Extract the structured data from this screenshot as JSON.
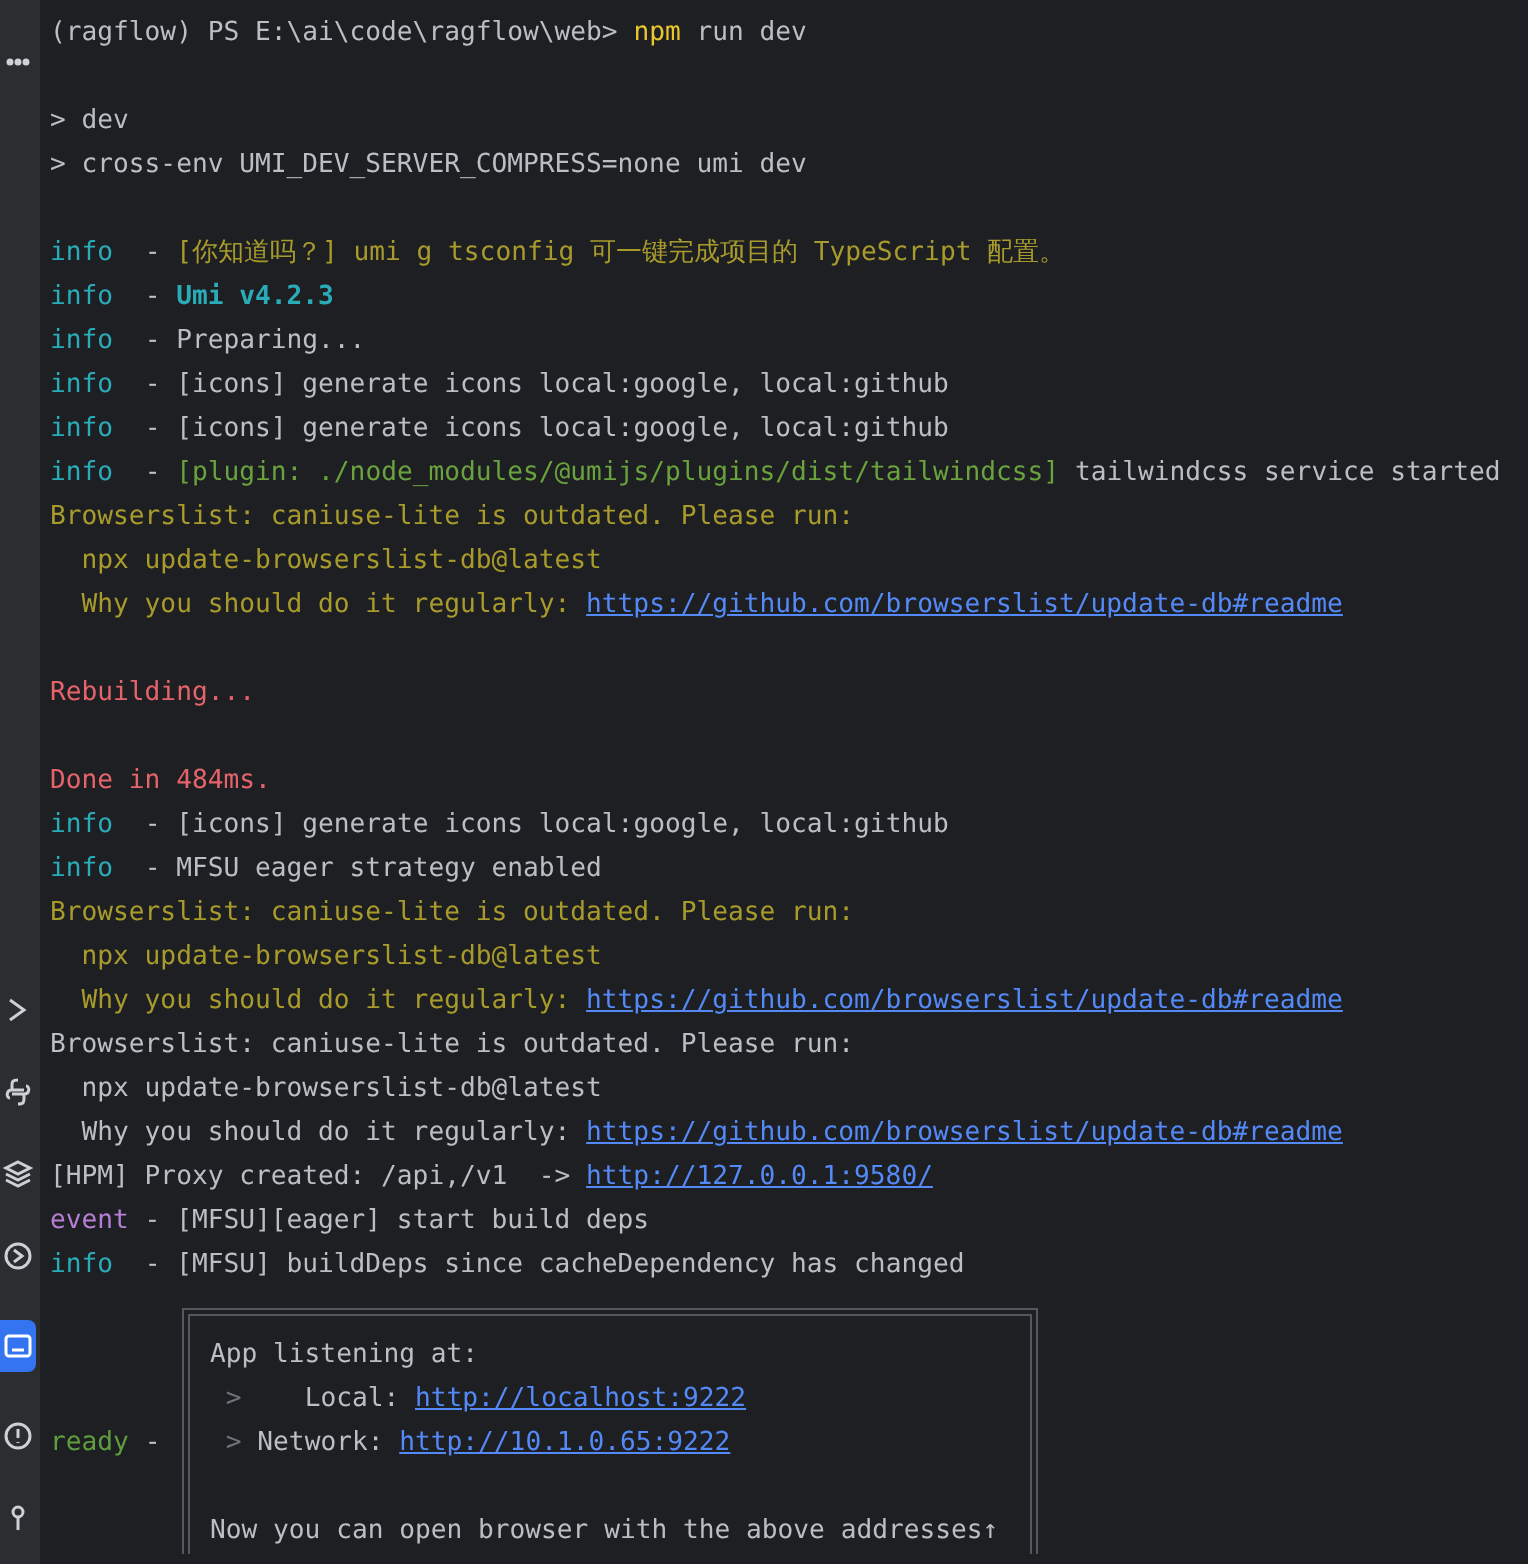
{
  "sidebar": {
    "items": [
      {
        "selected": false
      },
      {
        "selected": false
      },
      {
        "selected": false
      },
      {
        "selected": false
      },
      {
        "selected": false
      },
      {
        "selected": true
      },
      {
        "selected": false
      },
      {
        "selected": false
      }
    ]
  },
  "terminal": {
    "lines": [
      {
        "kind": "text",
        "segments": [
          {
            "kind": "plain",
            "text": "(ragflow) PS E:\\ai\\code\\ragflow\\web> "
          },
          {
            "kind": "command",
            "text": "npm"
          },
          {
            "kind": "plain",
            "text": " run dev"
          }
        ]
      },
      {
        "kind": "blank"
      },
      {
        "kind": "text",
        "segments": [
          {
            "kind": "plain",
            "text": "> dev"
          }
        ]
      },
      {
        "kind": "text",
        "segments": [
          {
            "kind": "plain",
            "text": "> cross-env UMI_DEV_SERVER_COMPRESS=none umi dev"
          }
        ]
      },
      {
        "kind": "blank"
      },
      {
        "kind": "text",
        "segments": [
          {
            "kind": "info",
            "text": "info"
          },
          {
            "kind": "plain",
            "text": "  - "
          },
          {
            "kind": "warn",
            "text": "[你知道吗？] umi g tsconfig 可一键完成项目的 TypeScript 配置。"
          }
        ]
      },
      {
        "kind": "text",
        "segments": [
          {
            "kind": "info",
            "text": "info"
          },
          {
            "kind": "plain",
            "text": "  - "
          },
          {
            "kind": "version",
            "text": "Umi v4.2.3"
          }
        ]
      },
      {
        "kind": "text",
        "segments": [
          {
            "kind": "info",
            "text": "info"
          },
          {
            "kind": "plain",
            "text": "  - Preparing..."
          }
        ]
      },
      {
        "kind": "text",
        "segments": [
          {
            "kind": "info",
            "text": "info"
          },
          {
            "kind": "plain",
            "text": "  - [icons] generate icons local:google, local:github"
          }
        ]
      },
      {
        "kind": "text",
        "segments": [
          {
            "kind": "info",
            "text": "info"
          },
          {
            "kind": "plain",
            "text": "  - [icons] generate icons local:google, local:github"
          }
        ]
      },
      {
        "kind": "text",
        "segments": [
          {
            "kind": "info",
            "text": "info"
          },
          {
            "kind": "plain",
            "text": "  - "
          },
          {
            "kind": "plugin",
            "text": "[plugin: ./node_modules/@umijs/plugins/dist/tailwindcss]"
          },
          {
            "kind": "plain",
            "text": " tailwindcss service started"
          }
        ]
      },
      {
        "kind": "text",
        "segments": [
          {
            "kind": "warn",
            "text": "Browserslist: caniuse-lite is outdated. Please run:"
          }
        ]
      },
      {
        "kind": "text",
        "segments": [
          {
            "kind": "warn",
            "text": "  npx update-browserslist-db@latest"
          }
        ]
      },
      {
        "kind": "text",
        "segments": [
          {
            "kind": "warn",
            "text": "  Why you should do it regularly: "
          },
          {
            "kind": "link",
            "text": "https://github.com/browserslist/update-db#readme"
          }
        ]
      },
      {
        "kind": "blank"
      },
      {
        "kind": "text",
        "segments": [
          {
            "kind": "error",
            "text": "Rebuilding..."
          }
        ]
      },
      {
        "kind": "blank"
      },
      {
        "kind": "text",
        "segments": [
          {
            "kind": "error",
            "text": "Done in 484ms."
          }
        ]
      },
      {
        "kind": "text",
        "segments": [
          {
            "kind": "info",
            "text": "info"
          },
          {
            "kind": "plain",
            "text": "  - [icons] generate icons local:google, local:github"
          }
        ]
      },
      {
        "kind": "text",
        "segments": [
          {
            "kind": "info",
            "text": "info"
          },
          {
            "kind": "plain",
            "text": "  - MFSU eager strategy enabled"
          }
        ]
      },
      {
        "kind": "text",
        "segments": [
          {
            "kind": "warn",
            "text": "Browserslist: caniuse-lite is outdated. Please run:"
          }
        ]
      },
      {
        "kind": "text",
        "segments": [
          {
            "kind": "warn",
            "text": "  npx update-browserslist-db@latest"
          }
        ]
      },
      {
        "kind": "text",
        "segments": [
          {
            "kind": "warn",
            "text": "  Why you should do it regularly: "
          },
          {
            "kind": "link",
            "text": "https://github.com/browserslist/update-db#readme"
          }
        ]
      },
      {
        "kind": "text",
        "segments": [
          {
            "kind": "plain",
            "text": "Browserslist: caniuse-lite is outdated. Please run:"
          }
        ]
      },
      {
        "kind": "text",
        "segments": [
          {
            "kind": "plain",
            "text": "  npx update-browserslist-db@latest"
          }
        ]
      },
      {
        "kind": "text",
        "segments": [
          {
            "kind": "plain",
            "text": "  Why you should do it regularly: "
          },
          {
            "kind": "link",
            "text": "https://github.com/browserslist/update-db#readme"
          }
        ]
      },
      {
        "kind": "text",
        "segments": [
          {
            "kind": "plain",
            "text": "[HPM] Proxy created: /api,/v1  -> "
          },
          {
            "kind": "link",
            "text": "http://127.0.0.1:9580/"
          }
        ]
      },
      {
        "kind": "text",
        "segments": [
          {
            "kind": "event",
            "text": "event"
          },
          {
            "kind": "plain",
            "text": " - [MFSU][eager] start build deps"
          }
        ]
      },
      {
        "kind": "text",
        "segments": [
          {
            "kind": "info",
            "text": "info"
          },
          {
            "kind": "plain",
            "text": "  - [MFSU] buildDeps since cacheDependency has changed"
          }
        ]
      }
    ],
    "ready": {
      "level_label": "ready",
      "separator": "-",
      "box_lines": [
        {
          "kind": "text",
          "segments": [
            {
              "kind": "plain",
              "text": "App listening at:"
            }
          ]
        },
        {
          "kind": "text",
          "segments": [
            {
              "kind": "dim",
              "text": " >"
            },
            {
              "kind": "plain",
              "text": "    Local: "
            },
            {
              "kind": "link",
              "text": "http://localhost:9222"
            }
          ]
        },
        {
          "kind": "text",
          "segments": [
            {
              "kind": "dim",
              "text": " >"
            },
            {
              "kind": "plain",
              "text": " Network: "
            },
            {
              "kind": "link",
              "text": "http://10.1.0.65:9222"
            }
          ]
        },
        {
          "kind": "blank"
        },
        {
          "kind": "text",
          "segments": [
            {
              "kind": "plain",
              "text": "Now you can open browser with the above addresses↑"
            }
          ]
        }
      ]
    }
  }
}
